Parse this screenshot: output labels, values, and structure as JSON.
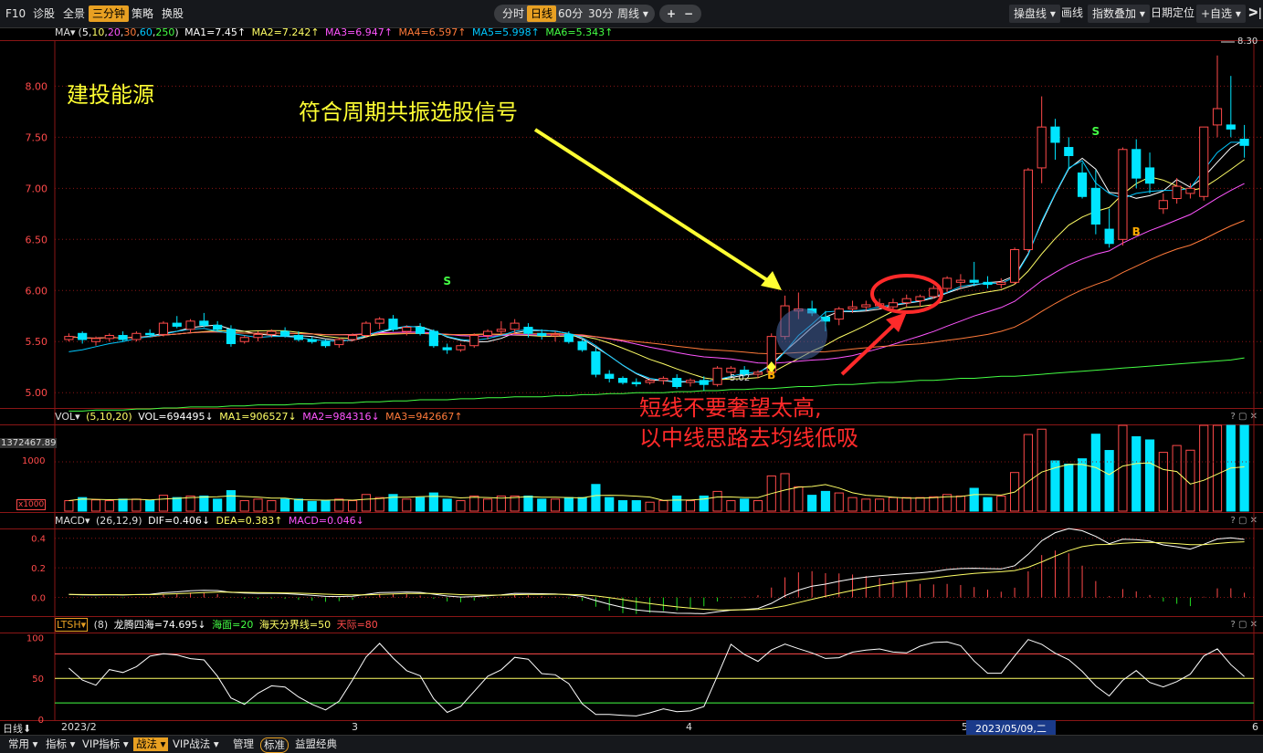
{
  "toolbar": {
    "f10": "F10",
    "diagnose": "诊股",
    "full_screen": "全景",
    "three_min": "三分钟",
    "strategy": "策略",
    "switch_stock": "换股",
    "period_tabs": [
      "分时",
      "日线",
      "60分",
      "30分",
      "周线 ▾"
    ],
    "zoom_in": "+",
    "zoom_out": "−",
    "right_buttons": [
      "操盘线 ▾",
      "画线",
      "指数叠加 ▾",
      "日期定位",
      "+自选 ▾"
    ],
    "collapse": "ᐳ|"
  },
  "ma_header": {
    "label": "MA▾",
    "params_prefix": "(",
    "p1": "5",
    "p2": "10",
    "p3": "20",
    "p4": "30",
    "p5": "60",
    "p6": "250",
    "params_suffix": ")",
    "ma1": "MA1=7.45↑",
    "ma2": "MA2=7.242↑",
    "ma3": "MA3=6.947↑",
    "ma4": "MA4=6.597↑",
    "ma5": "MA5=5.998↑",
    "ma6": "MA6=5.343↑"
  },
  "vol_header": {
    "label": "VOL▾",
    "params": "(5,10,20)",
    "vol": "VOL=694495↓",
    "ma1": "MA1=906527↓",
    "ma2": "MA2=984316↓",
    "ma3": "MA3=942667↑"
  },
  "macd_header": {
    "label": "MACD▾",
    "params": "(26,12,9)",
    "dif": "DIF=0.406↓",
    "dea": "DEA=0.383↑",
    "macd": "MACD=0.046↓"
  },
  "ltsh_header": {
    "label": "LTSH▾",
    "params": "(8)",
    "main": "龙腾四海=74.695↓",
    "sea": "海面=20",
    "line": "海天分界线=50",
    "sky": "天际=80"
  },
  "panel_controls": "? ▢ ✕",
  "stock_name": "建投能源",
  "annotation_signal": "符合周期共振选股信号",
  "annotation_advice_1": "短线不要奢望太高,",
  "annotation_advice_2": "以中线思路去均线低吸",
  "high_label": "8.30",
  "low_label": "5.02",
  "vol_axis_top": "1372467.89",
  "vol_axis_mid": "1000",
  "vol_axis_unit": "x1000",
  "signals": {
    "s": "S",
    "b": "B"
  },
  "x_axis": {
    "period": "日线⬇",
    "d1": "2023/2",
    "d2": "3",
    "d3": "4",
    "d4": "5",
    "d5": "6",
    "cursor": "2023/05/09,二"
  },
  "bottom": {
    "items": [
      "常用 ▾",
      "指标 ▾",
      "VIP指标 ▾",
      "战法 ▾",
      "VIP战法 ▾",
      "管理",
      "标准",
      "益盟经典"
    ]
  },
  "colors": {
    "up": "#ff4a4a",
    "down": "#00e5ff",
    "ma1": "#ffffff",
    "ma2": "#ffff66",
    "ma3": "#ff55ff",
    "ma4": "#ff7a3a",
    "ma5": "#00c8ff",
    "ma6": "#44ff44",
    "grid": "#8a1616",
    "accent": "#e8a022"
  },
  "chart_data": {
    "type": "candlestick",
    "title": "建投能源",
    "y_ticks": [
      5.0,
      5.5,
      6.0,
      6.5,
      7.0,
      7.5,
      8.0
    ],
    "ylim": [
      4.85,
      8.45
    ],
    "x_labels": [
      "2023/2",
      "3",
      "4",
      "5",
      "6"
    ],
    "candles": [
      [
        5.52,
        5.58,
        5.5,
        5.55
      ],
      [
        5.58,
        5.6,
        5.48,
        5.52
      ],
      [
        5.5,
        5.55,
        5.46,
        5.53
      ],
      [
        5.53,
        5.58,
        5.5,
        5.56
      ],
      [
        5.56,
        5.6,
        5.5,
        5.52
      ],
      [
        5.52,
        5.6,
        5.5,
        5.58
      ],
      [
        5.58,
        5.62,
        5.54,
        5.57
      ],
      [
        5.57,
        5.7,
        5.55,
        5.68
      ],
      [
        5.68,
        5.75,
        5.63,
        5.65
      ],
      [
        5.62,
        5.72,
        5.58,
        5.7
      ],
      [
        5.7,
        5.78,
        5.64,
        5.66
      ],
      [
        5.66,
        5.7,
        5.6,
        5.62
      ],
      [
        5.62,
        5.66,
        5.45,
        5.48
      ],
      [
        5.5,
        5.56,
        5.48,
        5.54
      ],
      [
        5.54,
        5.6,
        5.5,
        5.57
      ],
      [
        5.57,
        5.62,
        5.54,
        5.6
      ],
      [
        5.6,
        5.64,
        5.54,
        5.56
      ],
      [
        5.56,
        5.6,
        5.5,
        5.52
      ],
      [
        5.52,
        5.55,
        5.48,
        5.5
      ],
      [
        5.5,
        5.52,
        5.44,
        5.46
      ],
      [
        5.47,
        5.54,
        5.44,
        5.52
      ],
      [
        5.52,
        5.58,
        5.5,
        5.56
      ],
      [
        5.56,
        5.7,
        5.54,
        5.68
      ],
      [
        5.68,
        5.74,
        5.62,
        5.72
      ],
      [
        5.72,
        5.76,
        5.6,
        5.62
      ],
      [
        5.6,
        5.66,
        5.56,
        5.64
      ],
      [
        5.64,
        5.68,
        5.56,
        5.58
      ],
      [
        5.6,
        5.62,
        5.44,
        5.46
      ],
      [
        5.44,
        5.48,
        5.38,
        5.42
      ],
      [
        5.42,
        5.48,
        5.4,
        5.46
      ],
      [
        5.46,
        5.58,
        5.44,
        5.56
      ],
      [
        5.56,
        5.62,
        5.52,
        5.6
      ],
      [
        5.6,
        5.7,
        5.56,
        5.62
      ],
      [
        5.62,
        5.72,
        5.58,
        5.68
      ],
      [
        5.64,
        5.68,
        5.54,
        5.58
      ],
      [
        5.58,
        5.62,
        5.52,
        5.56
      ],
      [
        5.56,
        5.6,
        5.5,
        5.57
      ],
      [
        5.57,
        5.6,
        5.48,
        5.5
      ],
      [
        5.5,
        5.52,
        5.4,
        5.42
      ],
      [
        5.4,
        5.44,
        5.15,
        5.18
      ],
      [
        5.18,
        5.22,
        5.1,
        5.14
      ],
      [
        5.14,
        5.16,
        5.08,
        5.1
      ],
      [
        5.1,
        5.14,
        5.06,
        5.09
      ],
      [
        5.1,
        5.14,
        5.08,
        5.12
      ],
      [
        5.12,
        5.16,
        5.08,
        5.14
      ],
      [
        5.14,
        5.18,
        5.04,
        5.06
      ],
      [
        5.1,
        5.14,
        5.06,
        5.12
      ],
      [
        5.12,
        5.16,
        5.02,
        5.08
      ],
      [
        5.08,
        5.26,
        5.06,
        5.24
      ],
      [
        5.2,
        5.26,
        5.18,
        5.24
      ],
      [
        5.22,
        5.26,
        5.16,
        5.18
      ],
      [
        5.18,
        5.22,
        5.14,
        5.2
      ],
      [
        5.2,
        5.58,
        5.18,
        5.55
      ],
      [
        5.55,
        5.95,
        5.52,
        5.85
      ],
      [
        5.8,
        5.98,
        5.72,
        5.82
      ],
      [
        5.82,
        5.9,
        5.75,
        5.78
      ],
      [
        5.74,
        5.8,
        5.6,
        5.7
      ],
      [
        5.72,
        5.84,
        5.66,
        5.82
      ],
      [
        5.82,
        5.9,
        5.78,
        5.84
      ],
      [
        5.84,
        5.9,
        5.8,
        5.86
      ],
      [
        5.85,
        5.92,
        5.82,
        5.87
      ],
      [
        5.84,
        5.92,
        5.8,
        5.88
      ],
      [
        5.88,
        5.96,
        5.84,
        5.92
      ],
      [
        5.9,
        5.96,
        5.84,
        5.94
      ],
      [
        5.94,
        6.05,
        5.92,
        6.02
      ],
      [
        6.02,
        6.14,
        5.98,
        6.12
      ],
      [
        6.08,
        6.16,
        6.02,
        6.1
      ],
      [
        6.1,
        6.28,
        6.04,
        6.08
      ],
      [
        6.08,
        6.14,
        6.02,
        6.06
      ],
      [
        6.06,
        6.12,
        6.02,
        6.08
      ],
      [
        6.08,
        6.42,
        6.06,
        6.4
      ],
      [
        6.4,
        7.2,
        6.38,
        7.18
      ],
      [
        7.2,
        7.9,
        7.05,
        7.6
      ],
      [
        7.6,
        7.68,
        7.28,
        7.45
      ],
      [
        7.4,
        7.5,
        7.18,
        7.32
      ],
      [
        7.15,
        7.25,
        6.9,
        6.92
      ],
      [
        7.0,
        7.18,
        6.55,
        6.65
      ],
      [
        6.6,
        6.8,
        6.42,
        6.46
      ],
      [
        6.5,
        7.4,
        6.44,
        7.38
      ],
      [
        7.38,
        7.48,
        7.0,
        7.1
      ],
      [
        7.2,
        7.35,
        6.95,
        7.05
      ],
      [
        6.8,
        6.95,
        6.75,
        6.88
      ],
      [
        6.9,
        7.1,
        6.85,
        7.02
      ],
      [
        6.95,
        7.05,
        6.9,
        7.0
      ],
      [
        6.92,
        7.6,
        6.88,
        7.6
      ],
      [
        7.62,
        8.3,
        7.5,
        7.78
      ],
      [
        7.62,
        8.1,
        7.5,
        7.58
      ],
      [
        7.48,
        7.62,
        7.3,
        7.42
      ]
    ],
    "ma_series": {
      "MA5": [
        5.4,
        5.42,
        5.45,
        5.48,
        5.5,
        5.53,
        5.55,
        5.57,
        5.6,
        5.62,
        5.63,
        5.6,
        5.58,
        5.56,
        5.54,
        5.55,
        5.55,
        5.54,
        5.52,
        5.51,
        5.5,
        5.52,
        5.56,
        5.6,
        5.63,
        5.65,
        5.64,
        5.6,
        5.55,
        5.52,
        5.51,
        5.53,
        5.56,
        5.6,
        5.62,
        5.61,
        5.6,
        5.58,
        5.54,
        5.46,
        5.36,
        5.27,
        5.19,
        5.14,
        5.12,
        5.11,
        5.11,
        5.1,
        5.13,
        5.16,
        5.19,
        5.2,
        5.26,
        5.4,
        5.56,
        5.67,
        5.79,
        5.8,
        5.8,
        5.81,
        5.84,
        5.86,
        5.88,
        5.9,
        5.94,
        5.98,
        6.04,
        6.06,
        6.07,
        6.07,
        6.13,
        6.35,
        6.68,
        6.95,
        7.2,
        7.27,
        7.05,
        6.95,
        6.9,
        6.95,
        6.97,
        6.98,
        6.98,
        7.0,
        7.18,
        7.35,
        7.45,
        7.45
      ],
      "MA6": [
        4.82,
        4.82,
        4.83,
        4.83,
        4.83,
        4.84,
        4.84,
        4.85,
        4.85,
        4.86,
        4.86,
        4.86,
        4.87,
        4.87,
        4.88,
        4.88,
        4.88,
        4.89,
        4.89,
        4.9,
        4.9,
        4.9,
        4.91,
        4.91,
        4.92,
        4.92,
        4.93,
        4.93,
        4.93,
        4.94,
        4.94,
        4.95,
        4.95,
        4.96,
        4.96,
        4.96,
        4.97,
        4.97,
        4.98,
        4.98,
        4.99,
        4.99,
        5.0,
        5.0,
        5.0,
        5.01,
        5.01,
        5.02,
        5.02,
        5.03,
        5.03,
        5.04,
        5.04,
        5.05,
        5.06,
        5.06,
        5.07,
        5.08,
        5.08,
        5.09,
        5.1,
        5.1,
        5.11,
        5.12,
        5.12,
        5.13,
        5.14,
        5.14,
        5.15,
        5.16,
        5.16,
        5.17,
        5.18,
        5.19,
        5.2,
        5.21,
        5.22,
        5.23,
        5.24,
        5.25,
        5.26,
        5.27,
        5.28,
        5.29,
        5.3,
        5.31,
        5.32,
        5.34
      ]
    },
    "volume_label": "VOL=694495",
    "macd": {
      "dif": 0.406,
      "dea": 0.383,
      "macd": 0.046,
      "y_ticks": [
        0.0,
        0.2,
        0.4
      ]
    },
    "ltsh": {
      "value": 74.695,
      "levels": [
        20,
        50,
        80
      ],
      "y_ticks": [
        0,
        50,
        100
      ]
    },
    "annotations": {
      "high": 8.3,
      "low": 5.02
    }
  }
}
